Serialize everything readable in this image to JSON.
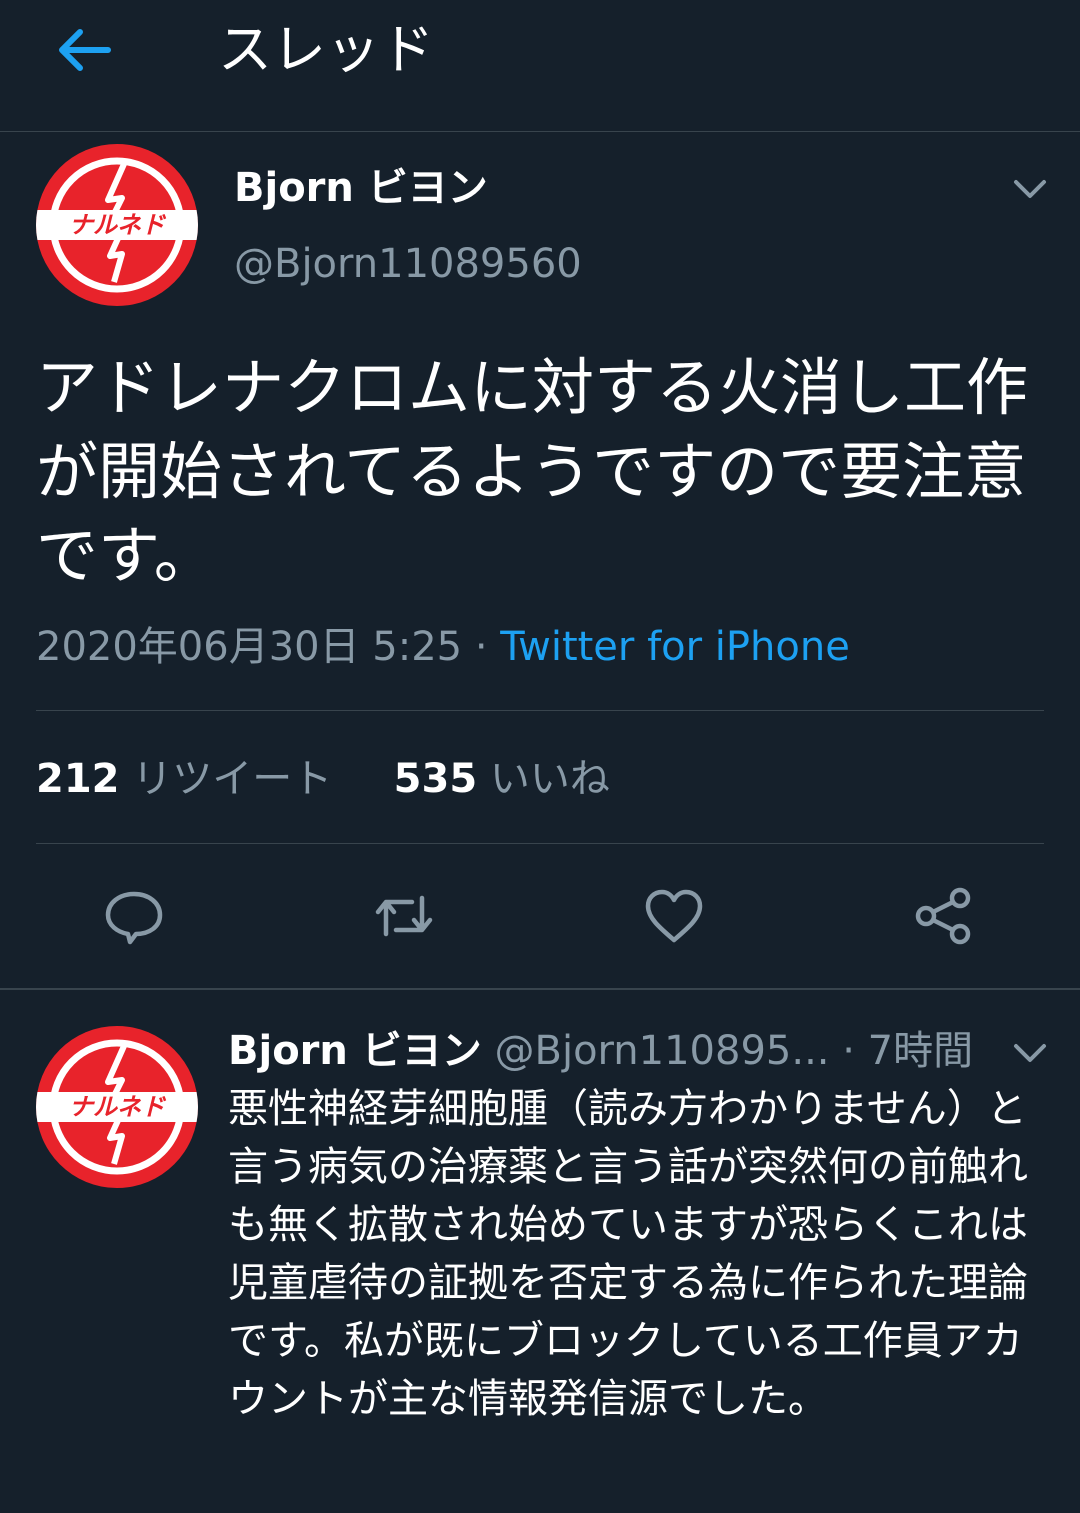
{
  "colors": {
    "background": "#15202b",
    "accent": "#1da1f2",
    "secondary_text": "#8899a6",
    "divider": "#38444d",
    "avatar_red": "#e8232b"
  },
  "header": {
    "back_icon": "arrow-left-icon",
    "title": "スレッド"
  },
  "tweet": {
    "author": {
      "name": "Bjorn ビヨン",
      "handle": "@Bjorn11089560",
      "avatar_text": "ナルネド"
    },
    "text": "アドレナクロムに対する火消し工作が開始されてるようですので要注意です。",
    "timestamp": "2020年06月30日 5:25",
    "separator": " · ",
    "source": "Twitter for iPhone",
    "stats": {
      "retweets_count": "212",
      "retweets_label": "リツイート",
      "likes_count": "535",
      "likes_label": "いいね"
    },
    "actions": [
      "reply-icon",
      "retweet-icon",
      "like-icon",
      "share-icon"
    ]
  },
  "reply": {
    "author": {
      "name": "Bjorn ビヨン",
      "handle": "@Bjorn110895...",
      "avatar_text": "ナルネド"
    },
    "time": "· 7時間",
    "text": "悪性神経芽細胞腫（読み方わかりません）と言う病気の治療薬と言う話が突然何の前触れも無く拡散され始めていますが恐らくこれは児童虐待の証拠を否定する為に作られた理論です。私が既にブロックしている工作員アカウントが主な情報発信源でした。"
  }
}
